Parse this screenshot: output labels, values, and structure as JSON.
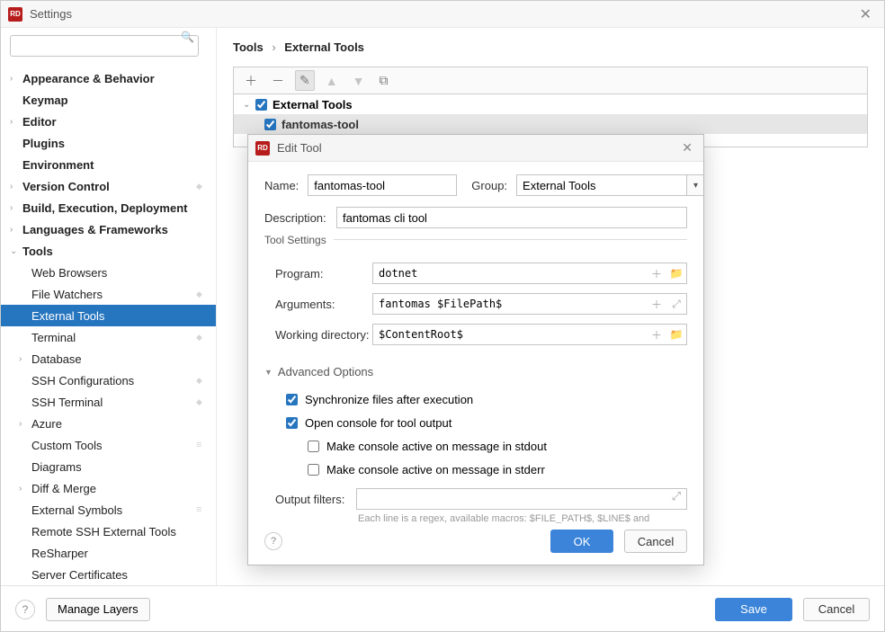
{
  "window": {
    "title": "Settings"
  },
  "search": {
    "placeholder": ""
  },
  "sidebar": {
    "items": [
      {
        "label": "Appearance & Behavior",
        "bold": true,
        "arrow": true
      },
      {
        "label": "Keymap",
        "bold": true
      },
      {
        "label": "Editor",
        "bold": true,
        "arrow": true
      },
      {
        "label": "Plugins",
        "bold": true
      },
      {
        "label": "Environment",
        "bold": true
      },
      {
        "label": "Version Control",
        "bold": true,
        "arrow": true,
        "badge": "dot"
      },
      {
        "label": "Build, Execution, Deployment",
        "bold": true,
        "arrow": true
      },
      {
        "label": "Languages & Frameworks",
        "bold": true,
        "arrow": true
      },
      {
        "label": "Tools",
        "bold": true,
        "arrow": true,
        "expanded": true
      }
    ],
    "tools_children": [
      {
        "label": "Web Browsers"
      },
      {
        "label": "File Watchers",
        "badge": "dot"
      },
      {
        "label": "External Tools",
        "selected": true
      },
      {
        "label": "Terminal",
        "badge": "dot"
      },
      {
        "label": "Database",
        "arrow": true
      },
      {
        "label": "SSH Configurations",
        "badge": "dot"
      },
      {
        "label": "SSH Terminal",
        "badge": "dot"
      },
      {
        "label": "Azure",
        "arrow": true
      },
      {
        "label": "Custom Tools",
        "badge": "grad"
      },
      {
        "label": "Diagrams"
      },
      {
        "label": "Diff & Merge",
        "arrow": true
      },
      {
        "label": "External Symbols",
        "badge": "grad"
      },
      {
        "label": "Remote SSH External Tools"
      },
      {
        "label": "ReSharper"
      },
      {
        "label": "Server Certificates"
      }
    ]
  },
  "breadcrumb": {
    "root": "Tools",
    "leaf": "External Tools"
  },
  "tools_list": {
    "group": "External Tools",
    "child": "fantomas-tool"
  },
  "dialog": {
    "title": "Edit Tool",
    "labels": {
      "name": "Name:",
      "group": "Group:",
      "description": "Description:",
      "tool_settings": "Tool Settings",
      "program": "Program:",
      "arguments": "Arguments:",
      "workdir": "Working directory:",
      "advanced": "Advanced Options",
      "sync": "Synchronize files after execution",
      "open_console": "Open console for tool output",
      "stdout": "Make console active on message in stdout",
      "stderr": "Make console active on message in stderr",
      "output_filters": "Output filters:",
      "hint": "Each line is a regex, available macros: $FILE_PATH$, $LINE$ and $COLUMN$"
    },
    "values": {
      "name": "fantomas-tool",
      "group": "External Tools",
      "description": "fantomas cli tool",
      "program": "dotnet",
      "arguments": "fantomas $FilePath$",
      "workdir": "$ContentRoot$",
      "output_filters": ""
    },
    "buttons": {
      "ok": "OK",
      "cancel": "Cancel"
    }
  },
  "footer": {
    "manage": "Manage Layers",
    "save": "Save",
    "cancel": "Cancel"
  }
}
